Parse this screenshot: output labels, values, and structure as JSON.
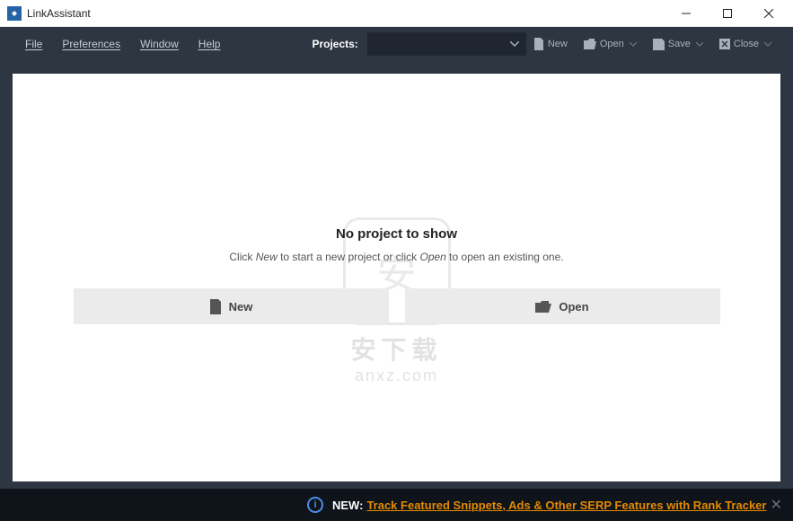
{
  "title": "LinkAssistant",
  "menu": {
    "file": "File",
    "preferences": "Preferences",
    "window": "Window",
    "help": "Help"
  },
  "toolbar": {
    "projects_label": "Projects:",
    "new": "New",
    "open": "Open",
    "save": "Save",
    "close": "Close"
  },
  "empty": {
    "title": "No project to show",
    "sub_prefix": "Click ",
    "sub_new": "New",
    "sub_mid": " to start a new project or click ",
    "sub_open": "Open",
    "sub_suffix": " to open an existing one.",
    "btn_new": "New",
    "btn_open": "Open"
  },
  "watermark": {
    "line1": "安下载",
    "line2": "anxz.com",
    "glyph": "安"
  },
  "notif": {
    "new_label": "NEW:",
    "link_text": "Track Featured Snippets, Ads & Other SERP Features with Rank Tracker"
  }
}
